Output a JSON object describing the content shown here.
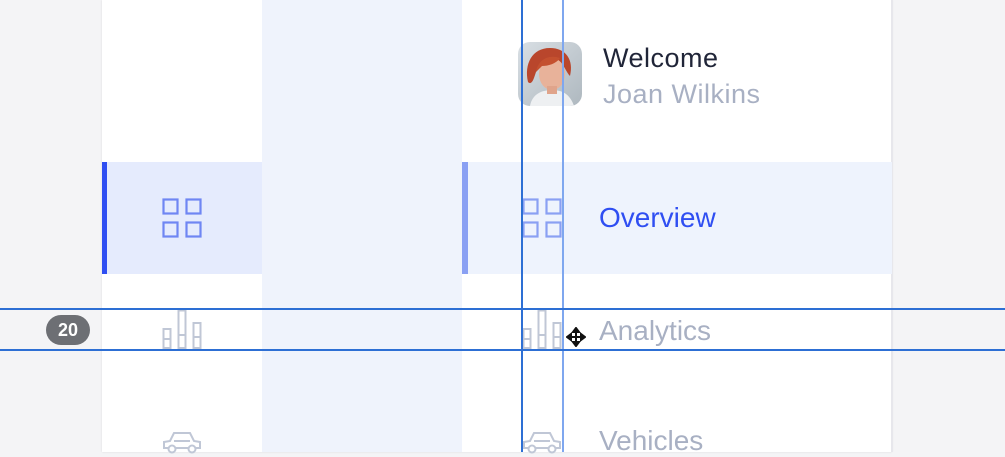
{
  "profile": {
    "greeting": "Welcome",
    "name": "Joan Wilkins"
  },
  "nav": {
    "items": [
      {
        "label": "Overview",
        "icon": "grid-icon",
        "active": true
      },
      {
        "label": "Analytics",
        "icon": "bar-chart-icon",
        "active": false
      },
      {
        "label": "Vehicles",
        "icon": "car-icon",
        "active": false
      }
    ]
  },
  "measure": {
    "spacing_badge": "20"
  },
  "colors": {
    "accent": "#2f4ef2",
    "accent_light": "#8aa0f3",
    "active_bg": "#e5ebfd",
    "muted_text": "#a8b0c3",
    "guide_line": "#2d6fd4",
    "badge_bg": "#6d6f74"
  }
}
